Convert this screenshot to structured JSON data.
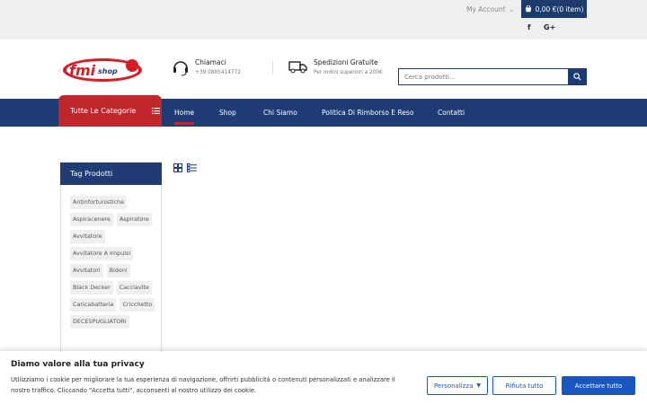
{
  "topbar": {
    "my_account": "My Account",
    "cart": "0,00 €(0 item)",
    "social": [
      "f",
      "G+"
    ]
  },
  "header": {
    "logo_text": "fmi shop",
    "call": {
      "title": "Chiamaci",
      "sub": "+39 0885414772"
    },
    "shipping": {
      "title": "Spedizioni Gratuite",
      "sub": "Per ordini superiori a 200€"
    },
    "search_placeholder": "Cerca prodotti..."
  },
  "nav": {
    "categories": "Tutte Le Categorie",
    "items": [
      "Home",
      "Shop",
      "Chi Siamo",
      "Politica Di Rimborso E Reso",
      "Contatti"
    ]
  },
  "sidebar": {
    "title": "Tag Prodotti",
    "tags": [
      "Antinfortunistiche",
      "Aspiracenere",
      "Aspiratore",
      "Avvitatore",
      "Avvitatore A Impulsi",
      "Avvitatori",
      "Bidoni",
      "Black Decker",
      "Cacciavite",
      "Caricabatteria",
      "Cricchetto",
      "DECESPUGLIATORI"
    ]
  },
  "cookie": {
    "title": "Diamo valore alla tua privacy",
    "text": "Utilizziamo i cookie per migliorare la tua esperienza di navigazione, offrirti pubblicità o contenuti personalizzati e analizzare il nostro traffico. Cliccando \"Accetta tutti\", acconsenti al nostro utilizzo dei cookie.",
    "customize": "Personalizza",
    "reject": "Rifiuta tutto",
    "accept": "Accettare tutto"
  },
  "colors": {
    "brand_blue": "#1f3c74",
    "brand_red": "#c0272d",
    "cookie_blue": "#1a56c2"
  }
}
